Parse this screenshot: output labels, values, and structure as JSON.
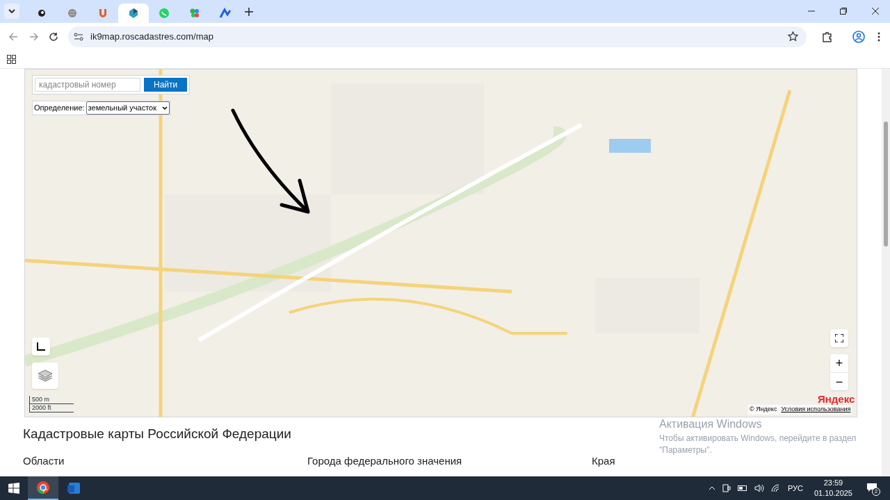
{
  "browser": {
    "tabs": [
      {
        "kind": "eye",
        "selected": false
      },
      {
        "kind": "globe",
        "selected": false
      },
      {
        "kind": "magnet",
        "selected": false
      },
      {
        "kind": "cube",
        "selected": true
      },
      {
        "kind": "chat",
        "selected": false
      },
      {
        "kind": "dots",
        "selected": false
      },
      {
        "kind": "logo",
        "selected": false
      }
    ],
    "url": "ik9map.roscadastres.com/map"
  },
  "map": {
    "search": {
      "placeholder": "кадастровый номер",
      "button": "Найти"
    },
    "definition": {
      "label": "Определение:",
      "value": "земельный участок"
    },
    "scale": [
      "500 m",
      "2000 ft"
    ],
    "zoom": {
      "plus": "+",
      "minus": "−"
    },
    "copyright": "© Яндекс",
    "terms": "Условия использования",
    "logo": "Яндекс"
  },
  "page": {
    "title": "Кадастровые карты Российской Федерации",
    "columns": [
      "Области",
      "Города федерального значения",
      "Края"
    ]
  },
  "activation": {
    "title": "Активация Windows",
    "text": "Чтобы активировать Windows, перейдите в раздел \"Параметры\"."
  },
  "taskbar": {
    "apps": [
      {
        "kind": "chrome",
        "selected": true
      },
      {
        "kind": "word",
        "selected": false
      }
    ],
    "language": "РУС",
    "time": "23:59",
    "date": "01.10.2025",
    "notifications": "2"
  }
}
